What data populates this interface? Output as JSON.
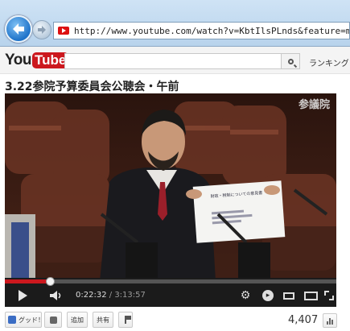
{
  "browser": {
    "url": "http://www.youtube.com/watch?v=KbtIlsPLnds&feature=my_liked_v"
  },
  "header": {
    "logo_you": "You",
    "logo_tube": "Tube",
    "search_value": "",
    "ranking_label": "ランキング"
  },
  "video": {
    "title": "3.22参院予算委員会公聴会・午前",
    "watermark": "参議院",
    "document_text": "財政・税制についての意見書",
    "current_time": "0:22:32",
    "duration": "3:13:57",
    "progress_fraction": 0.138
  },
  "actions": {
    "like_label": "グッド！",
    "add_label": "追加",
    "share_label": "共有",
    "views": "4,407"
  },
  "colors": {
    "accent_red": "#cc181e",
    "chrome_blue": "#1f73c9"
  }
}
